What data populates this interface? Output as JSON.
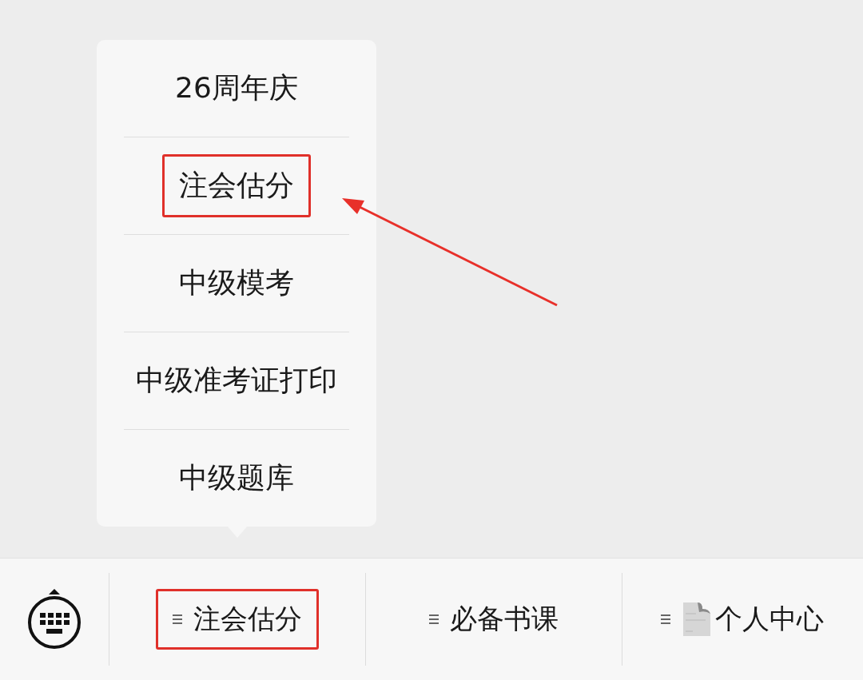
{
  "popup_menu": {
    "items": [
      {
        "label": "26周年庆",
        "highlighted": false
      },
      {
        "label": "注会估分",
        "highlighted": true
      },
      {
        "label": "中级模考",
        "highlighted": false
      },
      {
        "label": "中级准考证打印",
        "highlighted": false
      },
      {
        "label": "中级题库",
        "highlighted": false
      }
    ]
  },
  "bottom_menu": {
    "tabs": [
      {
        "label": "注会估分",
        "highlighted": true,
        "kind": "plain"
      },
      {
        "label": "必备书课",
        "highlighted": false,
        "kind": "plain"
      },
      {
        "label": "个人中心",
        "highlighted": false,
        "kind": "document"
      }
    ]
  },
  "annotations": [
    {
      "kind": "arrow"
    }
  ]
}
